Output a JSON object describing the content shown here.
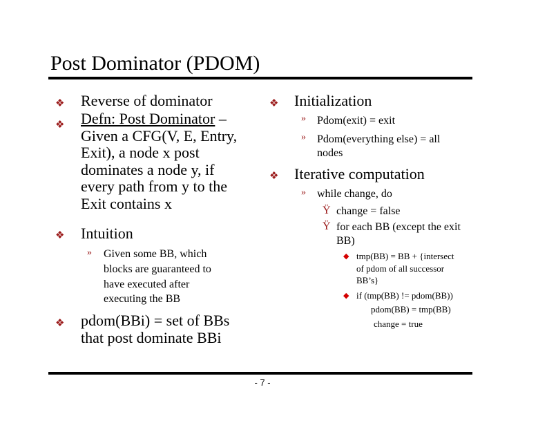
{
  "slide": {
    "title": "Post Dominator (PDOM)",
    "page_number": "- 7 -"
  },
  "left_column": {
    "bullet1": "Reverse of dominator",
    "bullet2": {
      "underlined": "Defn: Post Dominator",
      "rest_first_line": " –",
      "lines": [
        "Given a CFG(V, E, Entry,",
        "Exit), a node x post",
        "dominates a node y, if",
        "every path from y to the",
        "Exit contains x"
      ]
    },
    "bullet3": "Intuition",
    "sub_bullet": {
      "lines": [
        "Given some BB, which",
        "blocks are guaranteed to",
        "have executed after",
        "executing the BB"
      ]
    },
    "bullet4": {
      "lines": [
        "pdom(BBi) = set of BBs",
        "that post dominate BBi"
      ]
    }
  },
  "right_column": {
    "initialization": {
      "label": "Initialization",
      "items": [
        {
          "lines": [
            "Pdom(exit) = exit"
          ]
        },
        {
          "lines": [
            "Pdom(everything else) = all",
            "nodes"
          ]
        }
      ]
    },
    "iterative": {
      "label": "Iterative computation",
      "sub": "while change, do",
      "steps": [
        {
          "lines": [
            "change = false"
          ]
        },
        {
          "lines": [
            "for each BB (except the exit",
            "BB)"
          ]
        }
      ],
      "inner": [
        {
          "lines": [
            "tmp(BB) = BB + {intersect",
            "of pdom  of all successor",
            "BB’s}"
          ]
        },
        {
          "lines": [
            "if (tmp(BB) != pdom(BB))",
            "pdom(BB) = tmp(BB)",
            "change = true"
          ]
        }
      ]
    }
  },
  "icons": {
    "level1": "❖",
    "level2": "»",
    "level3": "Ÿ",
    "level4": "◆"
  },
  "colors": {
    "bullet": "#9b1b1b",
    "diamond_bullet": "#d40000",
    "rule": "#000000"
  }
}
